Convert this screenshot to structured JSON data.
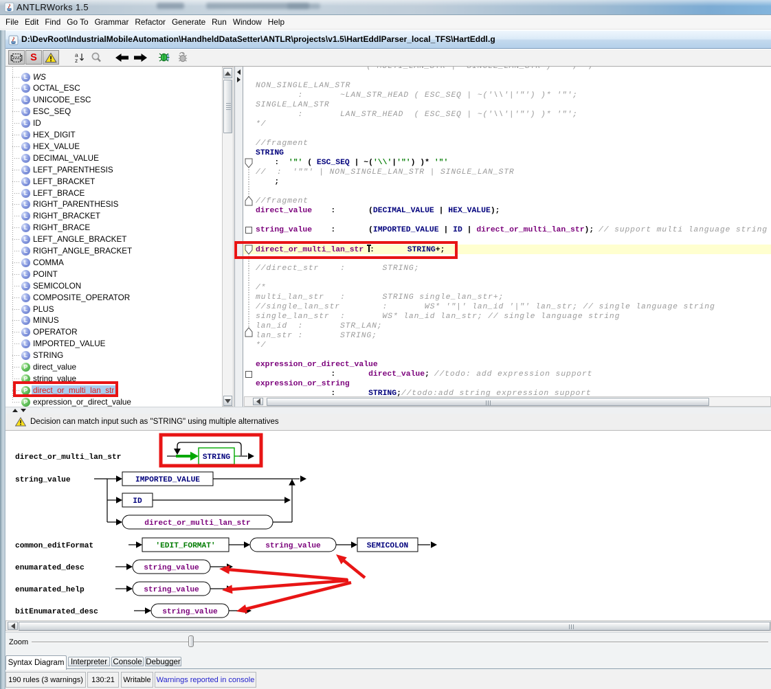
{
  "window": {
    "title": "ANTLRWorks 1.5"
  },
  "menu": {
    "items": [
      "File",
      "Edit",
      "Find",
      "Go To",
      "Grammar",
      "Refactor",
      "Generate",
      "Run",
      "Window",
      "Help"
    ]
  },
  "document_bar": {
    "path": "D:\\DevRoot\\IndustrialMobileAutomation\\HandheldDataSetter\\ANTLR\\projects\\v1.5\\HartEddlParser_local_TFS\\HartEddl.g"
  },
  "toolbar": {
    "buttons": [
      {
        "name": "syntax-diagram-toggle",
        "icon": "railroad-diagram-icon"
      },
      {
        "name": "syntax-coloring-toggle",
        "icon": "red-s-icon",
        "letter": "S"
      },
      {
        "name": "show-warnings-toggle",
        "icon": "warning-triangle-icon"
      },
      {
        "name": "sort-rules-button",
        "icon": "sort-az-icon"
      },
      {
        "name": "find-button",
        "icon": "magnifier-icon"
      },
      {
        "name": "back-button",
        "icon": "arrow-left-icon"
      },
      {
        "name": "forward-button",
        "icon": "arrow-right-icon"
      },
      {
        "name": "debug-button",
        "icon": "bug-icon"
      },
      {
        "name": "debug-remote-button",
        "icon": "bug-attach-icon"
      }
    ]
  },
  "rule_tree": {
    "items": [
      {
        "label": "WS",
        "kind": "lexer",
        "italic": true
      },
      {
        "label": "OCTAL_ESC",
        "kind": "lexer"
      },
      {
        "label": "UNICODE_ESC",
        "kind": "lexer"
      },
      {
        "label": "ESC_SEQ",
        "kind": "lexer"
      },
      {
        "label": "ID",
        "kind": "lexer"
      },
      {
        "label": "HEX_DIGIT",
        "kind": "lexer"
      },
      {
        "label": "HEX_VALUE",
        "kind": "lexer"
      },
      {
        "label": "DECIMAL_VALUE",
        "kind": "lexer"
      },
      {
        "label": "LEFT_PARENTHESIS",
        "kind": "lexer"
      },
      {
        "label": "LEFT_BRACKET",
        "kind": "lexer"
      },
      {
        "label": "LEFT_BRACE",
        "kind": "lexer"
      },
      {
        "label": "RIGHT_PARENTHESIS",
        "kind": "lexer"
      },
      {
        "label": "RIGHT_BRACKET",
        "kind": "lexer"
      },
      {
        "label": "RIGHT_BRACE",
        "kind": "lexer"
      },
      {
        "label": "LEFT_ANGLE_BRACKET",
        "kind": "lexer"
      },
      {
        "label": "RIGHT_ANGLE_BRACKET",
        "kind": "lexer"
      },
      {
        "label": "COMMA",
        "kind": "lexer"
      },
      {
        "label": "POINT",
        "kind": "lexer"
      },
      {
        "label": "SEMICOLON",
        "kind": "lexer"
      },
      {
        "label": "COMPOSITE_OPERATOR",
        "kind": "lexer"
      },
      {
        "label": "PLUS",
        "kind": "lexer"
      },
      {
        "label": "MINUS",
        "kind": "lexer"
      },
      {
        "label": "OPERATOR",
        "kind": "lexer"
      },
      {
        "label": "IMPORTED_VALUE",
        "kind": "lexer"
      },
      {
        "label": "STRING",
        "kind": "lexer"
      },
      {
        "label": "direct_value",
        "kind": "parser"
      },
      {
        "label": "string_value",
        "kind": "parser"
      },
      {
        "label": "direct_or_multi_lan_str",
        "kind": "parser",
        "selected": true
      },
      {
        "label": "expression_or_direct_value",
        "kind": "parser"
      }
    ]
  },
  "editor": {
    "lines": [
      {
        "segs": [
          [
            "c",
            "                     ( MULTI_LAN_STR |  SINGLE_LAN_STR )*  ';' ;"
          ]
        ]
      },
      {
        "segs": []
      },
      {
        "segs": [
          [
            "c",
            "NON_SINGLE_LAN_STR"
          ]
        ]
      },
      {
        "segs": [
          [
            "c",
            "        :       ~LAN_STR_HEAD ( ESC_SEQ | ~('\\\\'|'\"') )* '\"';"
          ]
        ]
      },
      {
        "segs": [
          [
            "c",
            "SINGLE_LAN_STR"
          ]
        ]
      },
      {
        "segs": [
          [
            "c",
            "        :       LAN_STR_HEAD  ( ESC_SEQ | ~('\\\\'|'\"') )* '\"';"
          ]
        ]
      },
      {
        "segs": [
          [
            "c",
            "*/"
          ]
        ]
      },
      {
        "segs": []
      },
      {
        "segs": [
          [
            "c",
            "//fragment"
          ]
        ]
      },
      {
        "segs": [
          [
            "t",
            "STRING"
          ]
        ]
      },
      {
        "segs": [
          [
            "k",
            "    :  "
          ],
          [
            "s",
            "'\"'"
          ],
          [
            "k",
            " ( "
          ],
          [
            "t",
            "ESC_SEQ"
          ],
          [
            "k",
            " | ~("
          ],
          [
            "s",
            "'\\\\'"
          ],
          [
            "k",
            "|"
          ],
          [
            "s",
            "'\"'"
          ],
          [
            "k",
            ") )* "
          ],
          [
            "s",
            "'\"'"
          ]
        ]
      },
      {
        "segs": [
          [
            "c",
            "//  :  '\"\"' | NON_SINGLE_LAN_STR | SINGLE_LAN_STR"
          ]
        ]
      },
      {
        "segs": [
          [
            "k",
            "    ;"
          ]
        ]
      },
      {
        "segs": []
      },
      {
        "segs": [
          [
            "c",
            "//fragment"
          ]
        ]
      },
      {
        "segs": [
          [
            "r",
            "direct_value"
          ],
          [
            "k",
            "    :       ("
          ],
          [
            "t",
            "DECIMAL_VALUE"
          ],
          [
            "k",
            " | "
          ],
          [
            "t",
            "HEX_VALUE"
          ],
          [
            "k",
            ");"
          ]
        ]
      },
      {
        "segs": []
      },
      {
        "segs": [
          [
            "r",
            "string_value"
          ],
          [
            "k",
            "    :       ("
          ],
          [
            "t",
            "IMPORTED_VALUE"
          ],
          [
            "k",
            " | "
          ],
          [
            "t",
            "ID"
          ],
          [
            "k",
            " | "
          ],
          [
            "r",
            "direct_or_multi_lan_str"
          ],
          [
            "k",
            "); "
          ],
          [
            "c",
            "// support multi language string"
          ]
        ]
      },
      {
        "segs": []
      },
      {
        "segs": [
          [
            "r",
            "direct_or_multi_lan_str"
          ],
          [
            "k",
            " "
          ],
          [
            "caret",
            ""
          ],
          [
            "k",
            ":       "
          ],
          [
            "t",
            "STRING"
          ],
          [
            "k",
            "+;"
          ]
        ],
        "highlight": true
      },
      {
        "segs": []
      },
      {
        "segs": [
          [
            "c",
            "//direct_str    :       STRING;"
          ]
        ]
      },
      {
        "segs": []
      },
      {
        "segs": [
          [
            "c",
            "/*"
          ]
        ]
      },
      {
        "segs": [
          [
            "c",
            "multi_lan_str   :       STRING single_lan_str+;"
          ]
        ]
      },
      {
        "segs": [
          [
            "c",
            "//single_lan_str        :       WS* '\"|' lan_id '|\"' lan_str; // single language string"
          ]
        ]
      },
      {
        "segs": [
          [
            "c",
            "single_lan_str  :       WS* lan_id lan_str; // single language string"
          ]
        ]
      },
      {
        "segs": [
          [
            "c",
            "lan_id  :       STR_LAN;"
          ]
        ]
      },
      {
        "segs": [
          [
            "c",
            "lan_str :       STRING;"
          ]
        ]
      },
      {
        "segs": [
          [
            "c",
            "*/"
          ]
        ]
      },
      {
        "segs": []
      },
      {
        "segs": [
          [
            "r",
            "expression_or_direct_value"
          ]
        ]
      },
      {
        "segs": [
          [
            "k",
            "                :       "
          ],
          [
            "r",
            "direct_value"
          ],
          [
            "k",
            "; "
          ],
          [
            "c",
            "//todo: add expression support"
          ]
        ]
      },
      {
        "segs": [
          [
            "r",
            "expression_or_string"
          ]
        ]
      },
      {
        "segs": [
          [
            "k",
            "                :       "
          ],
          [
            "t",
            "STRING"
          ],
          [
            "k",
            ";"
          ],
          [
            "c",
            "//todo:add string expression support"
          ]
        ]
      }
    ]
  },
  "warning_bar": {
    "text": "Decision can match input such as \"STRING\" using multiple alternatives"
  },
  "diagram": {
    "rows": [
      {
        "label": "direct_or_multi_lan_str",
        "loop_node": "STRING"
      },
      {
        "label": "string_value",
        "alts": [
          "IMPORTED_VALUE",
          "ID",
          "direct_or_multi_lan_str"
        ]
      },
      {
        "label": "common_editFormat",
        "seq": [
          "'EDIT_FORMAT'",
          "string_value",
          "SEMICOLON"
        ]
      },
      {
        "label": "enumarated_desc",
        "seq": [
          "string_value"
        ]
      },
      {
        "label": "enumarated_help",
        "seq": [
          "string_value"
        ]
      },
      {
        "label": "bitEnumarated_desc",
        "seq": [
          "string_value"
        ]
      }
    ]
  },
  "zoom": {
    "label": "Zoom"
  },
  "tabs": {
    "items": [
      "Syntax Diagram",
      "Interpreter",
      "Console",
      "Debugger"
    ],
    "active": 0
  },
  "status": {
    "cells": [
      {
        "text": "190 rules (3 warnings)"
      },
      {
        "text": "130:21"
      },
      {
        "text": "Writable"
      },
      {
        "text": "Warnings reported in console",
        "link": true
      }
    ]
  },
  "colors": {
    "annotation_red": "#e81515",
    "rule_purple": "#7b017b",
    "token_navy": "#00007c",
    "literal_green": "#007c00",
    "comment_gray": "#9b9b9b",
    "highlight_line": "#ffffcf",
    "selection_blue": "#a9cdee",
    "selected_text_red": "#e01f1f"
  }
}
